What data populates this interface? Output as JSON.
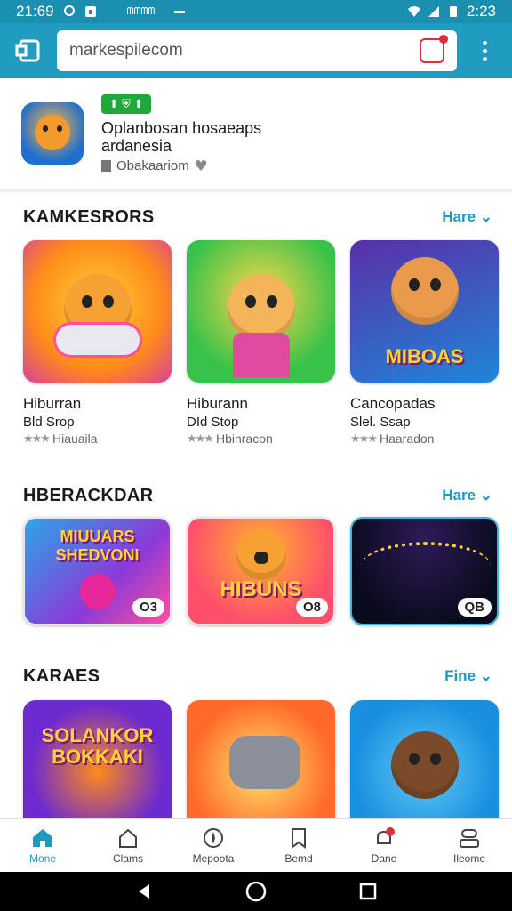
{
  "status": {
    "time_left": "21:69",
    "signal_text": "ᗰᗰᗰᗰ",
    "time_right": "2:23"
  },
  "toolbar": {
    "url": "markespilecom"
  },
  "app": {
    "badge": "⬆ ⛨ ⬆",
    "title_line1": "Oplanbosan hosaeaps",
    "title_line2": "ardanesia",
    "meta": "Obakaariom"
  },
  "sections": [
    {
      "title": "KAMKESRORS",
      "more": "Hare",
      "cards": [
        {
          "title": "Hiburran",
          "sub": "Bld Srop",
          "rating_text": "Hiauaila",
          "colors": [
            "#ff8a1a",
            "#ffd23a"
          ]
        },
        {
          "title": "Hiburann",
          "sub": "DId Stop",
          "rating_text": "Hbinracon",
          "colors": [
            "#38c24a",
            "#ffd64a"
          ]
        },
        {
          "title": "Cancopadas",
          "sub": "Slel. Ssap",
          "rating_text": "Haaradon",
          "caption": "MIBOAS",
          "colors": [
            "#5a2fa8",
            "#1f86d8"
          ]
        }
      ]
    },
    {
      "title": "HBERACKDAR",
      "more": "Hare",
      "cards": [
        {
          "caption": "MIUUARS SHEDVONI",
          "chip": "O3",
          "colors": [
            "#2da6e8",
            "#ff4fa0"
          ]
        },
        {
          "caption": "HIBUNS",
          "chip": "O8",
          "colors": [
            "#ff4f6a",
            "#ffb52e"
          ]
        },
        {
          "chip": "QB",
          "colors": [
            "#0a0a1e",
            "#2d1b57"
          ]
        }
      ]
    },
    {
      "title": "KARAES",
      "more": "Fine",
      "cards": [
        {
          "caption": "SOLANKOR BOKKAKI",
          "colors": [
            "#6d2ad0",
            "#ff8a1a"
          ]
        },
        {
          "colors": [
            "#ff6a2a",
            "#ffb52e"
          ]
        },
        {
          "colors": [
            "#1a8fe0",
            "#5fcaf5"
          ]
        }
      ]
    }
  ],
  "bottom_nav": [
    {
      "label": "Mone",
      "icon": "home-icon",
      "active": true
    },
    {
      "label": "Clams",
      "icon": "house-outline-icon"
    },
    {
      "label": "Mepoota",
      "icon": "compass-icon"
    },
    {
      "label": "Bemd",
      "icon": "bookmark-icon"
    },
    {
      "label": "Dane",
      "icon": "notification-icon"
    },
    {
      "label": "Ileome",
      "icon": "profile-icon"
    }
  ],
  "colors": {
    "accent": "#1e9abf",
    "toolbar": "#1f9cbf",
    "badge_green": "#21a83a",
    "tab_red": "#d8303a"
  }
}
